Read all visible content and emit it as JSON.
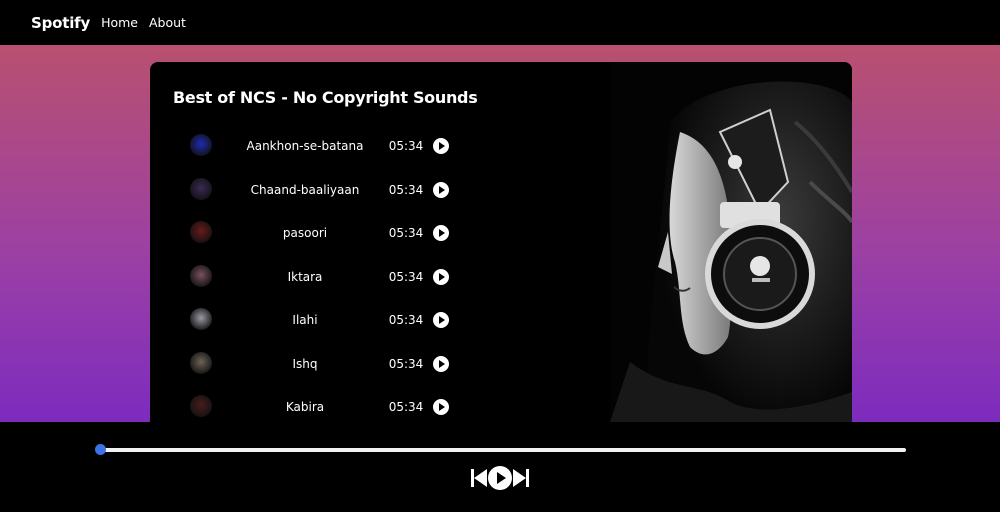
{
  "navbar": {
    "brand": "Spotify",
    "links": [
      "Home",
      "About"
    ]
  },
  "playlist": {
    "title": "Best of NCS - No Copyright Sounds",
    "songs": [
      {
        "name": "Aankhon-se-batana",
        "duration": "05:34",
        "cover_color": "#1d2bb5"
      },
      {
        "name": "Chaand-baaliyaan",
        "duration": "05:34",
        "cover_color": "#3a2a55"
      },
      {
        "name": "pasoori",
        "duration": "05:34",
        "cover_color": "#6b1a1a"
      },
      {
        "name": "Iktara",
        "duration": "05:34",
        "cover_color": "#7a5060"
      },
      {
        "name": "Ilahi",
        "duration": "05:34",
        "cover_color": "#9a9aa6"
      },
      {
        "name": "Ishq",
        "duration": "05:34",
        "cover_color": "#6d6358"
      },
      {
        "name": "Kabira",
        "duration": "05:34",
        "cover_color": "#4a1c1c"
      }
    ]
  },
  "player": {
    "progress": 0.0,
    "accent": "#3b73e6"
  },
  "icons": {
    "play_song": "play-circle-icon",
    "previous": "backward-step-icon",
    "main_play": "play-circle-icon",
    "next": "forward-step-icon"
  }
}
